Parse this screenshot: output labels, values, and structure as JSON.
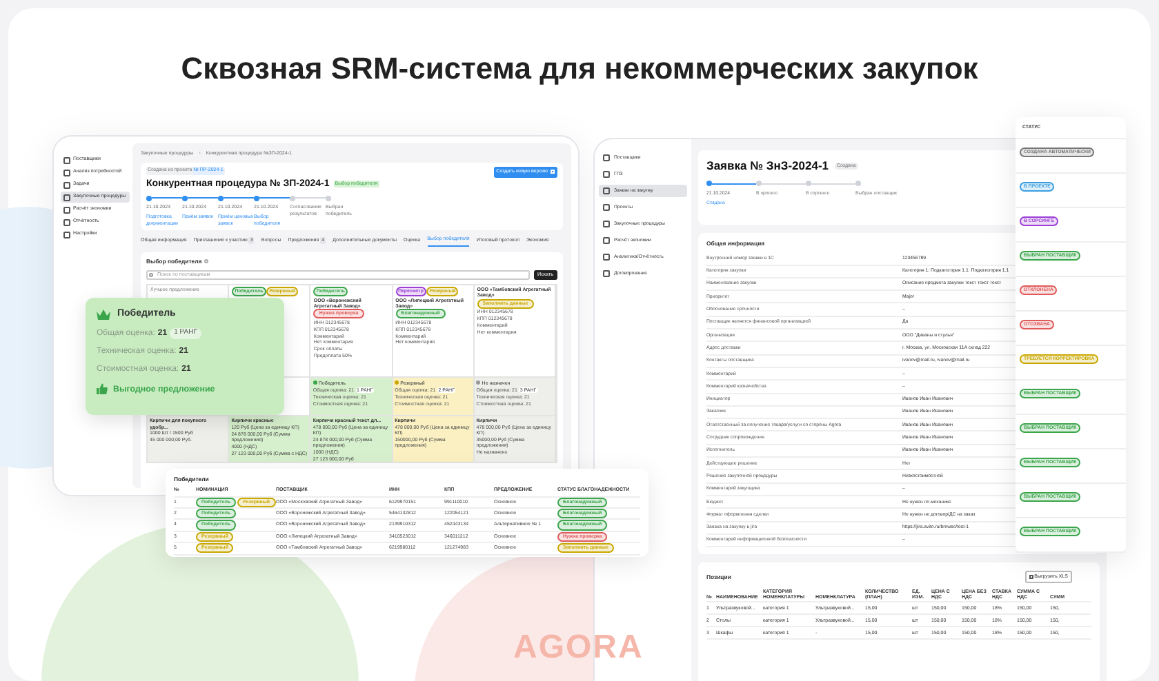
{
  "headline": "Сквозная SRM-система для некоммерческих закупок",
  "procedure_window": {
    "sidebar": [
      {
        "label": "Поставщики",
        "selected": false
      },
      {
        "label": "Анализ потребностей",
        "selected": false
      },
      {
        "label": "Задачи",
        "selected": false
      },
      {
        "label": "Закупочные процедуры",
        "selected": true
      },
      {
        "label": "Расчёт экономии",
        "selected": false
      },
      {
        "label": "Отчётность",
        "selected": false
      },
      {
        "label": "Настройки",
        "selected": false
      }
    ],
    "breadcrumbs": [
      "Закупочные процедуры",
      "Конкурентная процедура №ЗП-2024-1"
    ],
    "breadcrumb_separator": "›",
    "source_label": "Создана из проекта",
    "source_link": "№ ПР-2024-1",
    "title": "Конкурентная процедура № ЗП-2024-1",
    "status_badge": "Выбор победителя",
    "new_version_button": "Создать новую версию",
    "steps": [
      {
        "date": "21.10.2024",
        "label": "Подготовка документации",
        "completed": true
      },
      {
        "date": "21.10.2024",
        "label": "Приём заявок",
        "completed": true
      },
      {
        "date": "21.10.2024",
        "label": "Приём ценовых заявок",
        "completed": true
      },
      {
        "date": "21.10.2024",
        "label": "Выбор победителя",
        "completed": true
      },
      {
        "label": "Согласование результатов",
        "completed": false
      },
      {
        "label": "Выбран победитель",
        "completed": false
      }
    ],
    "tabs": [
      {
        "label": "Общая информация",
        "selected": false
      },
      {
        "label": "Приглашение к участию",
        "count": "3",
        "selected": false
      },
      {
        "label": "Вопросы",
        "selected": false
      },
      {
        "label": "Предложения",
        "count": "4",
        "selected": false
      },
      {
        "label": "Дополнительные документы",
        "selected": false
      },
      {
        "label": "Оценка",
        "selected": false
      },
      {
        "label": "Выбор победителя",
        "selected": true
      },
      {
        "label": "Итоговый протокол",
        "selected": false
      },
      {
        "label": "Экономия",
        "selected": false
      }
    ],
    "section_title": "Выбор победителя",
    "search_placeholder": "Поиск по поставщикам",
    "search_button": "Искать",
    "suppliers": [
      {
        "header": "Лучшее предложение",
        "color": "#eeeeea",
        "prices": [
          "Кирпичи для покупного удобр...",
          "1000 Шт / 1500 Руб",
          "45 000 000,00 Руб."
        ]
      },
      {
        "tags": [
          {
            "label": "Победитель",
            "color": "#3aa54a"
          },
          {
            "label": "Резервный",
            "color": "#c9a800"
          }
        ],
        "color": "#d6efcc",
        "prices": [
          "Кирпичи красные",
          "120 Руб (Цена за единицу КП)",
          "24 878 000,00 Руб (Сумма предложения)",
          "4000 (НДС)",
          "27 123 000,00 Руб (Сумма с НДС)"
        ]
      },
      {
        "tags": [
          {
            "label": "Победитель",
            "color": "#3aa54a"
          }
        ],
        "name": "ООО «Воронежский Агрегатный Завод»",
        "flag": {
          "label": "Нужна проверка",
          "color": "#e05a5a"
        },
        "details": [
          "ИНН 012345678",
          "КПП 012345678",
          "Комментарий",
          "Нет комментария",
          "Срок оплаты",
          "Предоплата 50%"
        ],
        "score": {
          "status": {
            "label": "Победитель",
            "color": "#3aa54a"
          },
          "lines": [
            "Общая оценка: 21",
            "Техническая оценка: 21",
            "Стоимостная оценка: 21"
          ],
          "rank": "1 РАНГ"
        },
        "color": "#d6efcc",
        "prices": [
          "Кирпичи красный текст дл...",
          "478 000,00 Руб (Цена за единицу КП)",
          "24 878 000,00 Руб (Сумма предложения)",
          "1000 (НДС)",
          "27 123 000,00 Руб"
        ]
      },
      {
        "tags": [
          {
            "label": "Пересмотр",
            "color": "#9b3fd6"
          },
          {
            "label": "Резервный",
            "color": "#c9a800"
          }
        ],
        "name": "ООО «Липецкий Агрегатный Завод»",
        "flag": {
          "label": "Благонадежный",
          "color": "#3aa54a"
        },
        "details": [
          "ИНН 012345678",
          "КПП 012345678",
          "Комментарий",
          "Нет комментария"
        ],
        "score": {
          "status": {
            "label": "Резервный",
            "color": "#c9a800"
          },
          "lines": [
            "Общая оценка: 21",
            "Техническая оценка: 21",
            "Стоимостная оценка: 21"
          ],
          "rank": "2 РАНГ"
        },
        "color": "#faf0c2",
        "prices": [
          "Кирпичи",
          "478 000,00 Руб (Цена за единицу КП)",
          "150000,00 Руб (Сумма предложения)"
        ]
      },
      {
        "name": "ООО «Тамбовский Агрегатный Завод»",
        "flag": {
          "label": "Заполнить данные",
          "color": "#c9a800"
        },
        "details": [
          "ИНН 012345678",
          "КПП 012345678",
          "Комментарий",
          "Нет комментария"
        ],
        "score": {
          "status": {
            "label": "Не назначен",
            "color": "#999999"
          },
          "lines": [
            "Общая оценка: 21",
            "Техническая оценка: 21",
            "Стоимостная оценка: 21"
          ],
          "rank": "3 РАНГ"
        },
        "color": "#eeeeea",
        "prices": [
          "Кирпичи",
          "478 000,00 Руб (Цена за единицу КП)",
          "35000,00 Руб (Сумма предложения)",
          "Не назначено"
        ]
      }
    ]
  },
  "winner_card": {
    "title": "Победитель",
    "overall_label": "Общая оценка:",
    "overall_value": "21",
    "rank": "1 РАНГ",
    "tech_label": "Техническая оценка:",
    "tech_value": "21",
    "cost_label": "Стоимостная оценка:",
    "cost_value": "21",
    "benefit": "Выгодное предложение"
  },
  "winners_table": {
    "title": "Победители",
    "columns": [
      "№",
      "НОМИНАЦИЯ",
      "ПОСТАВЩИК",
      "ИНН",
      "КПП",
      "ПРЕДЛОЖЕНИЕ",
      "СТАТУС БЛАГОНАДЕЖНОСТИ"
    ],
    "rows": [
      {
        "n": "1",
        "nominations": [
          {
            "label": "Победитель",
            "color": "#3aa54a"
          },
          {
            "label": "Резервный",
            "color": "#c9a800"
          }
        ],
        "supplier": "ООО «Московский Агрегатный Завод»",
        "inn": "6129970151",
        "kpp": "991110010",
        "offer": "Основное",
        "status": {
          "label": "Благонадежный",
          "color": "#3aa54a"
        }
      },
      {
        "n": "2",
        "nominations": [
          {
            "label": "Победитель",
            "color": "#3aa54a"
          }
        ],
        "supplier": "ООО «Воронежский Агрегатный Завод»",
        "inn": "5464132812",
        "kpp": "122054121",
        "offer": "Основное",
        "status": {
          "label": "Благонадежный",
          "color": "#3aa54a"
        }
      },
      {
        "n": "4",
        "nominations": [
          {
            "label": "Победитель",
            "color": "#3aa54a"
          }
        ],
        "supplier": "ООО «Воронежский Агрегатный Завод»",
        "inn": "2139910312",
        "kpp": "452443134",
        "offer": "Альтернативное № 1",
        "status": {
          "label": "Благонадежный",
          "color": "#3aa54a"
        }
      },
      {
        "n": "3",
        "nominations": [
          {
            "label": "Резервный",
            "color": "#c9a800"
          }
        ],
        "supplier": "ООО «Липецкий Агрегатный Завод»",
        "inn": "3410523012",
        "kpp": "346011212",
        "offer": "Основное",
        "status": {
          "label": "Нужна проверка",
          "color": "#e05a5a"
        }
      },
      {
        "n": "5",
        "nominations": [
          {
            "label": "Резервный",
            "color": "#c9a800"
          }
        ],
        "supplier": "ООО «Тамбовский Агрегатный Завод»",
        "inn": "6219980112",
        "kpp": "121274983",
        "offer": "Основное",
        "status": {
          "label": "Заполнить данные",
          "color": "#c9a800"
        }
      }
    ]
  },
  "request_window": {
    "sidebar": [
      {
        "label": "Поставщики",
        "selected": false
      },
      {
        "label": "ГПЗ",
        "selected": false
      },
      {
        "label": "Заявки на закупку",
        "selected": true
      },
      {
        "label": "Проекты",
        "selected": false
      },
      {
        "label": "Закупочные процедуры",
        "selected": false
      },
      {
        "label": "Расчёт экономии",
        "selected": false
      },
      {
        "label": "Аналитика/Отчётность",
        "selected": false
      },
      {
        "label": "Договорование",
        "selected": false
      }
    ],
    "title": "Заявка № ЗнЗ-2024-1",
    "status_badge": "Создана",
    "steps": [
      {
        "date": "21.10.2024",
        "link": "Создана",
        "completed": true
      },
      {
        "label": "В проекте",
        "completed": false
      },
      {
        "label": "В сорсинге",
        "completed": false
      },
      {
        "label": "Выбран поставщик",
        "completed": false
      }
    ],
    "info_title": "Общая информация",
    "info": [
      {
        "label": "Внутренний номер заявки в 1С",
        "value": "123456789"
      },
      {
        "label": "Категория закупки",
        "value": "Категория 1: Подкатегория 1.1: Подкатегория 1.1"
      },
      {
        "label": "Наименование закупки",
        "value": "Описание предмета закупки текст текст текст"
      },
      {
        "label": "Приоритет",
        "value": "Major"
      },
      {
        "label": "Обоснование срочности",
        "value": "–"
      },
      {
        "label": "Поставщик является финансовой организацией",
        "value": "Да"
      },
      {
        "label": "Организация",
        "value": "ООО \"Диваны и стулья\""
      },
      {
        "label": "Адрес доставки",
        "value": "г. Москва, ул. Московская 11А склад 222"
      },
      {
        "label": "Контакты поставщика",
        "value": "ivanov@mail.ru, ivanov@mail.ru"
      },
      {
        "label": "Комментарий",
        "value": "–"
      },
      {
        "label": "Комментарий казначейства",
        "value": "–"
      },
      {
        "label": "Инициатор",
        "value": "Иванов Иван Иванович"
      },
      {
        "label": "Заказчик",
        "value": "Иванов Иван Иванович"
      },
      {
        "label": "Ответственный за получение товара/услуги со стороны Agora",
        "value": "Иванов Иван Иванович"
      },
      {
        "label": "Сотрудник сопровождения",
        "value": "Иванов Иван Иванович"
      },
      {
        "label": "Исполнитель",
        "value": "Иванов Иван Иванович"
      },
      {
        "label": "Действующее решение",
        "value": "Нет"
      },
      {
        "label": "Решение закупочной процедуры",
        "value": "Низкостоимостной"
      },
      {
        "label": "Комментарий закупщика",
        "value": "–"
      },
      {
        "label": "Бюджет",
        "value": "Не нужен по механике"
      },
      {
        "label": "Формат оформления сделки",
        "value": "Не нужен не договор/ДС на заказ"
      },
      {
        "label": "Заявка на закупку в jira",
        "value": "https://jira.avito.ru/browse/test-1"
      },
      {
        "label": "Комментарий информационной безопасности",
        "value": "–"
      }
    ],
    "positions_title": "Позиции",
    "export_button": "Выгрузить XLS",
    "positions_columns": [
      "№",
      "НАИМЕНОВАНИЕ",
      "КАТЕГОРИЯ НОМЕНКЛАТУРЫ",
      "НОМЕНКЛАТУРА",
      "КОЛИЧЕСТВО (ПЛАН)",
      "ЕД. ИЗМ.",
      "ЦЕНА С НДС",
      "ЦЕНА БЕЗ НДС",
      "СТАВКА НДС",
      "СУММА С НДС",
      "СУММ"
    ],
    "positions": [
      [
        "1",
        "Ультразвуковой...",
        "категория 1",
        "Ультразвуковой...",
        "15,00",
        "шт",
        "150,00",
        "150,00",
        "18%",
        "150,00",
        "150,"
      ],
      [
        "2",
        "Столы",
        "категория 1",
        "Ультразвуковой...",
        "15,00",
        "шт",
        "150,00",
        "150,00",
        "18%",
        "150,00",
        "150,"
      ],
      [
        "3",
        "Шкафы",
        "категория 1",
        "-",
        "15,00",
        "шт",
        "150,00",
        "150,00",
        "18%",
        "150,00",
        "150,"
      ]
    ]
  },
  "status_column": {
    "title": "СТАТУС",
    "statuses": [
      {
        "label": "СОЗДАНА АВТОМАТИЧЕСКИ",
        "color": "#777777"
      },
      {
        "label": "В ПРОЕКТЕ",
        "color": "#3a9ee0"
      },
      {
        "label": "В СОРСИНГЕ",
        "color": "#9b3fd6"
      },
      {
        "label": "ВЫБРАН ПОСТАВЩИК",
        "color": "#3aa54a"
      },
      {
        "label": "ОТКЛОНЕНА",
        "color": "#e05a5a"
      },
      {
        "label": "ОТОЗВАНА",
        "color": "#e05a5a"
      },
      {
        "label": "ТРЕБУЕТСЯ КОРРЕКТИРОВКА",
        "color": "#c9a800"
      },
      {
        "label": "ВЫБРАН ПОСТАВЩИК",
        "color": "#3aa54a"
      },
      {
        "label": "ВЫБРАН ПОСТАВЩИК",
        "color": "#3aa54a"
      },
      {
        "label": "ВЫБРАН ПОСТАВЩИК",
        "color": "#3aa54a"
      },
      {
        "label": "ВЫБРАН ПОСТАВЩИК",
        "color": "#3aa54a"
      },
      {
        "label": "ВЫБРАН ПОСТАВЩИК",
        "color": "#3aa54a"
      }
    ]
  },
  "logo": "AGORA"
}
